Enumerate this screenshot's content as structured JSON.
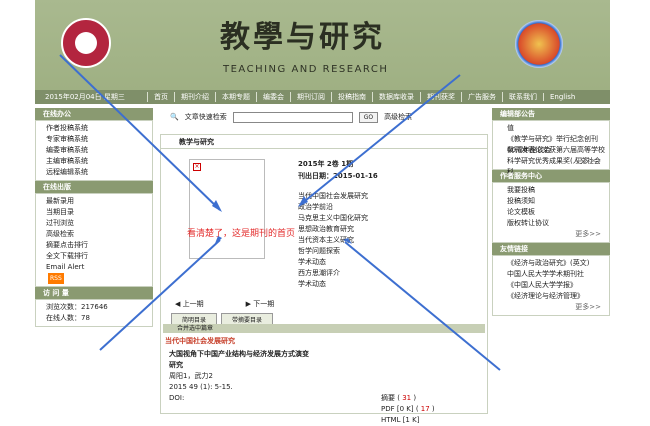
{
  "header": {
    "title_cn": "教學与研究",
    "title_en": "TEACHING AND RESEARCH"
  },
  "nav": {
    "date": "2015年02月04日 星期三",
    "items": [
      "首页",
      "期刊介绍",
      "本期专题",
      "编委会",
      "期刊订阅",
      "投稿指南",
      "数据库收录",
      "期刊获奖",
      "广告服务",
      "联系我们",
      "English"
    ]
  },
  "left": {
    "online_office": {
      "title": "在线办公",
      "items": [
        "作者投稿系统",
        "专家审稿系统",
        "编委审稿系统",
        "主编审稿系统",
        "远程编辑系统"
      ]
    },
    "online_pub": {
      "title": "在线出版",
      "items": [
        "最新录用",
        "当期目录",
        "过刊浏览",
        "高级检索",
        "摘要点击排行",
        "全文下载排行",
        "Email Alert"
      ],
      "rss": "RSS"
    },
    "visits": {
      "title": "访 问 量",
      "total_label": "浏览次数：",
      "total": "217646",
      "online_label": "在线人数：",
      "online": "78"
    }
  },
  "search": {
    "label": "文章快速检索",
    "go": "GO",
    "advanced": "高级检索"
  },
  "main": {
    "title": "教学与研究",
    "cover_mark": "×",
    "vol": "2015年 2卷 1期",
    "pub": "刊出日期：2015-01-16",
    "columns": [
      "当代中国社会发展研究",
      "政治学前沿",
      "马克思主义中国化研究",
      "思想政治教育研究",
      "当代资本主义研究",
      "哲学问题探索",
      "学术动态",
      "西方思潮评介",
      "学术动态"
    ],
    "prev": "上一期",
    "next": "下一期",
    "tab1": "简明目录",
    "tab2": "带摘要目录",
    "merged": "合并选中篇章",
    "section": "当代中国社会发展研究",
    "article": {
      "title": "大国视角下中国产业结构与经济发展方式演变研究",
      "authors": "周阳1，武力2",
      "ref": "2015 49 (1): 5-15.",
      "doi": "DOI:"
    },
    "links": {
      "abs": "摘要",
      "abs_n": "31",
      "pdf": "PDF [0 K]",
      "pdf_n": "17",
      "html": "HTML [1 K]"
    }
  },
  "right": {
    "notice": {
      "title": "编辑部公告",
      "items": [
        "值",
        "《教学与研究》举行纪念创刊60周年座谈会",
        "我刊发表论文获第六届高等学校科学研究优秀成果奖(人文社会科"
      ],
      "more": "更多>>"
    },
    "author": {
      "title": "作者服务中心",
      "items": [
        "我要投稿",
        "投稿须知",
        "论文模板",
        "版权转让协议"
      ],
      "more": "更多>>"
    },
    "links": {
      "title": "友情链接",
      "items": [
        "《经济与政治研究》(英文)",
        "中国人民大学学术期刊社",
        "《中国人民大学学报》",
        "《经济理论与经济管理》"
      ],
      "more": "更多>>"
    }
  },
  "annotation": "看清楚了，这是期刊的首页"
}
